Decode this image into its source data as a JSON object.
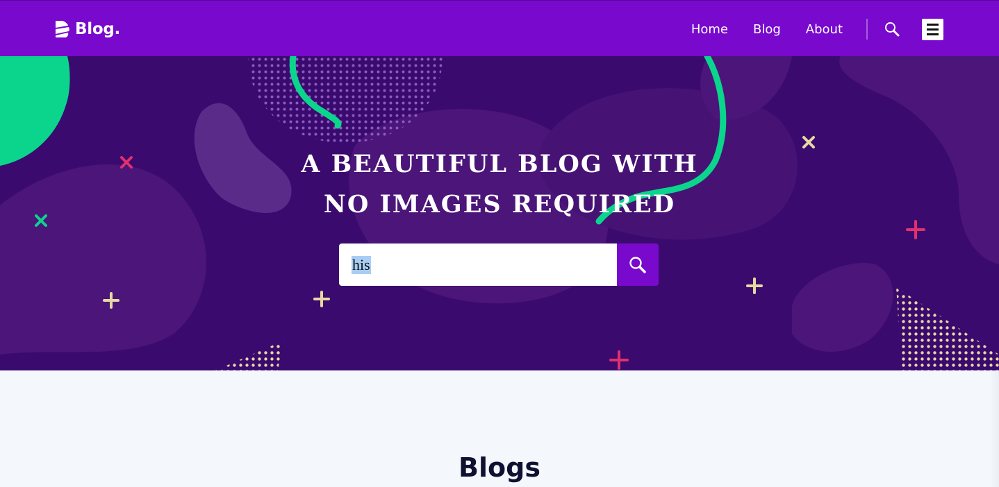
{
  "header": {
    "logo_text": "Blog.",
    "nav": [
      {
        "label": "Home"
      },
      {
        "label": "Blog"
      },
      {
        "label": "About"
      }
    ],
    "search_icon": "search-icon",
    "menu_icon": "hamburger-menu-icon"
  },
  "hero": {
    "title": "A BEAUTIFUL BLOG WITH NO IMAGES REQUIRED",
    "search": {
      "value": "his",
      "button_icon": "search-icon"
    }
  },
  "section": {
    "title": "Blogs"
  },
  "colors": {
    "header_bg": "#7809cd",
    "hero_bg": "#3b0a6e",
    "accent_green": "#0bd58c",
    "accent_pink": "#e0306e",
    "accent_cream": "#e7d8a2",
    "page_bg": "#f4f8fc"
  }
}
